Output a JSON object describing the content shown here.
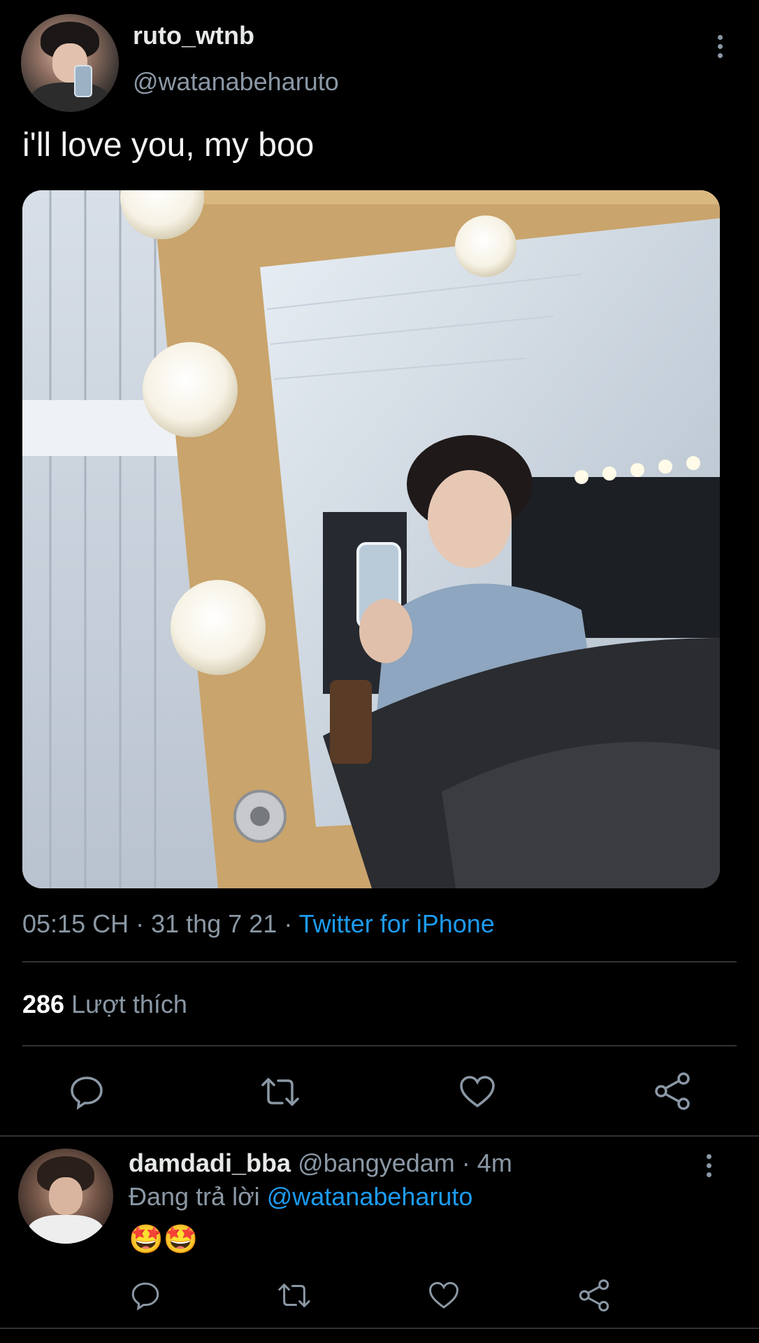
{
  "tweet": {
    "author": {
      "display_name": "ruto_wtnb",
      "handle": "@watanabeharuto"
    },
    "text": "i'll love you, my boo",
    "meta": {
      "time": "05:15 CH",
      "sep1": "·",
      "date": "31 thg 7 21",
      "sep2": "·",
      "source": "Twitter for iPhone"
    },
    "stats": {
      "likes_count": "286",
      "likes_label": "Lượt thích"
    },
    "actions": [
      "reply-icon",
      "retweet-icon",
      "like-icon",
      "share-icon"
    ]
  },
  "reply": {
    "author": {
      "display_name": "damdadi_bba",
      "handle": "@bangyedam",
      "sep": "·",
      "time": "4m"
    },
    "replying_prefix": "Đang trả lời",
    "replying_to": "@watanabeharuto",
    "text": "🤩🤩",
    "actions": [
      "reply-icon",
      "retweet-icon",
      "like-icon",
      "share-icon"
    ]
  },
  "colors": {
    "background": "#000000",
    "link": "#1d9bf0",
    "muted": "#8b98a5",
    "divider": "#2f3336"
  }
}
